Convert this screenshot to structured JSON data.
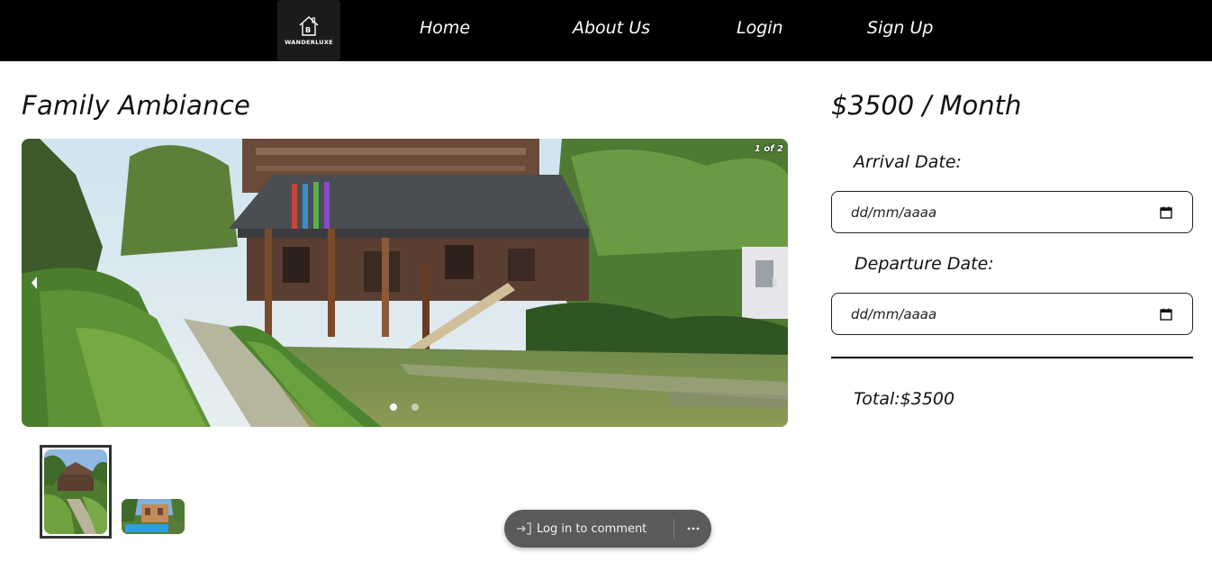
{
  "nav": {
    "logo_text": "WANDERLUXE",
    "links": [
      {
        "label": "Home"
      },
      {
        "label": "About Us"
      },
      {
        "label": "Login"
      },
      {
        "label": "Sign Up"
      }
    ]
  },
  "listing": {
    "title": "Family Ambiance",
    "carousel": {
      "counter": "1 of 2",
      "current_slide": 1,
      "total_slides": 2
    }
  },
  "comment": {
    "label": "Log in to comment"
  },
  "booking": {
    "price": "$3500 / Month",
    "arrival_label": "Arrival Date:",
    "arrival_placeholder": "dd/mm/aaaa",
    "departure_label": "Departure Date:",
    "departure_placeholder": "dd/mm/aaaa",
    "total": "Total:$3500"
  },
  "icons": {
    "logo": "house-logo-icon",
    "prev": "chevron-left-icon",
    "next": "chevron-right-icon",
    "calendar": "calendar-icon",
    "login": "sign-in-icon",
    "more": "more-horizontal-icon"
  },
  "colors": {
    "navbar": "#000000",
    "pill": "#5a5a5a",
    "text": "#111111"
  }
}
